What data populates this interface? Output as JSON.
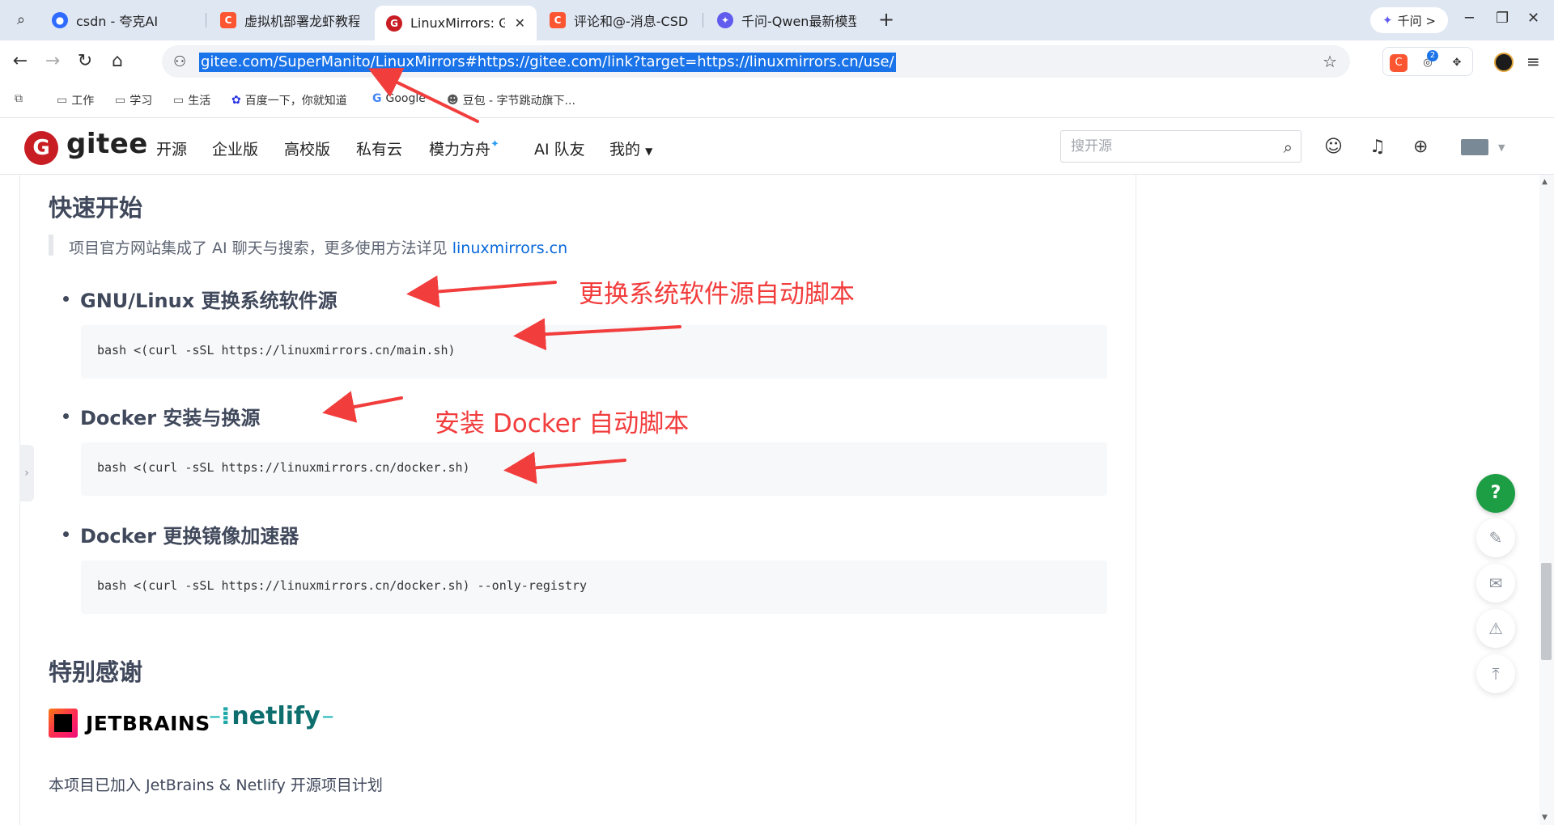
{
  "browser": {
    "tabs": [
      {
        "title": "csdn - 夸克AI",
        "favicon": "quark-icon",
        "color": "#2f6bff"
      },
      {
        "title": "虚拟机部署龙虾教程 C",
        "favicon": "csdn-icon",
        "color": "#fc5531"
      },
      {
        "title": "LinuxMirrors: GN",
        "favicon": "gitee-icon",
        "color": "#c71d23"
      },
      {
        "title": "评论和@-消息-CSDN",
        "favicon": "csdn-icon",
        "color": "#fc5531"
      },
      {
        "title": "千问-Qwen最新模型体",
        "favicon": "qwen-icon",
        "color": "#615ced"
      }
    ],
    "qianwen_label": "千问 >",
    "url": "gitee.com/SuperManito/LinuxMirrors#https://gitee.com/link?target=https://linuxmirrors.cn/use/",
    "extension_badge": "2",
    "bookmarks": [
      "工作",
      "学习",
      "生活",
      "百度一下，你就知道",
      "Google",
      "豆包 - 字节跳动旗下..."
    ]
  },
  "gitee": {
    "logo_text": "gitee",
    "nav": [
      "开源",
      "企业版",
      "高校版",
      "私有云",
      "模力方舟",
      "AI 队友",
      "我的"
    ],
    "search_placeholder": "搜开源"
  },
  "article": {
    "quick_start_heading": "快速开始",
    "quote_text": "项目官方网站集成了 AI 聊天与搜索，更多使用方法详见 ",
    "quote_link": "linuxmirrors.cn",
    "items": [
      {
        "title": "GNU/Linux 更换系统软件源",
        "code": "bash <(curl -sSL https://linuxmirrors.cn/main.sh)"
      },
      {
        "title": "Docker 安装与换源",
        "code": "bash <(curl -sSL https://linuxmirrors.cn/docker.sh)"
      },
      {
        "title": "Docker 更换镜像加速器",
        "code": "bash <(curl -sSL https://linuxmirrors.cn/docker.sh) --only-registry"
      }
    ],
    "thanks_heading": "特别感谢",
    "jetbrains_text": "JETBRAINS",
    "netlify_text": "netlify",
    "credits_text": "本项目已加入 JetBrains & Netlify 开源项目计划"
  },
  "annotations": {
    "mirror_script": "更换系统软件源自动脚本",
    "docker_script": "安装 Docker 自动脚本",
    "color": "#f23d3d"
  }
}
